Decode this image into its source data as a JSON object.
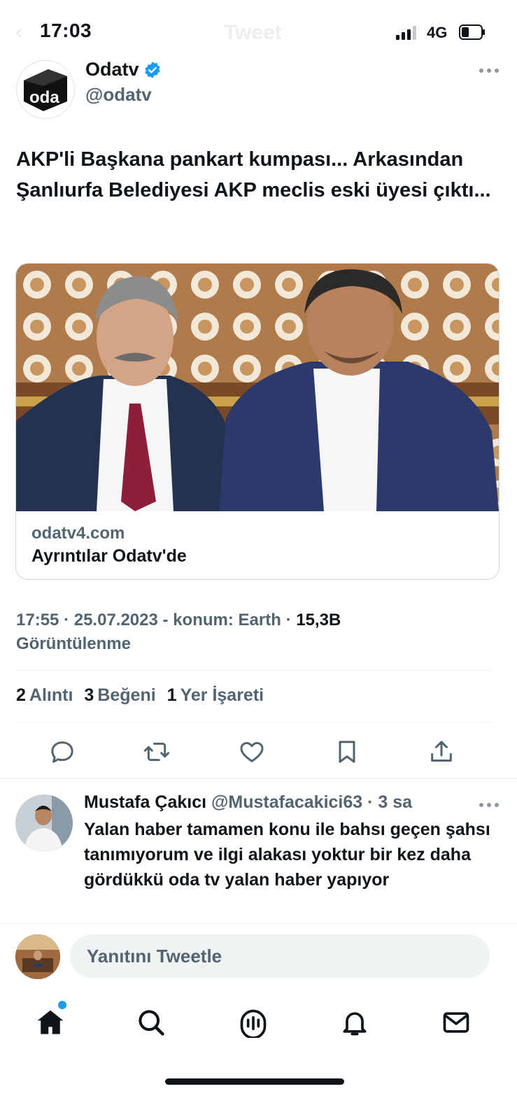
{
  "status_bar": {
    "time": "17:03",
    "network": "4G"
  },
  "background_header": {
    "back_glyph": "‹",
    "title": "Tweet"
  },
  "tweet": {
    "author_name": "Odatv",
    "author_handle": "@odatv",
    "logo_text": "oda",
    "text": "AKP'li Başkana pankart kumpası... Arkasından Şanlıurfa Belediyesi AKP meclis eski üyesi çıktı...",
    "card": {
      "domain": "odatv4.com",
      "title": "Ayrıntılar Odatv'de"
    },
    "meta": {
      "time": "17:55",
      "date": "25.07.2023",
      "location": "konum: Earth",
      "views": "15,3B",
      "views_label": "Görüntülenme"
    },
    "stats": [
      {
        "count": "2",
        "label": "Alıntı"
      },
      {
        "count": "3",
        "label": "Beğeni"
      },
      {
        "count": "1",
        "label": "Yer İşareti"
      }
    ],
    "actions": [
      "reply-icon",
      "retweet-icon",
      "like-icon",
      "bookmark-icon",
      "share-icon"
    ]
  },
  "reply": {
    "name": "Mustafa Çakıcı",
    "handle": "@Mustafacakici63",
    "time": "3 sa",
    "text": "Yalan haber tamamen  konu ile bahsı geçen şahsı tanımıyorum ve ilgi alakası yoktur bir kez daha gördükkü oda tv yalan haber yapıyor"
  },
  "compose": {
    "placeholder": "Yanıtını Tweetle"
  },
  "tab_bar": [
    "home-icon",
    "search-icon",
    "spaces-icon",
    "notifications-icon",
    "messages-icon"
  ],
  "colors": {
    "accent": "#1d9bf0",
    "text": "#0f1419",
    "muted": "#536471",
    "divider": "#eff3f4"
  }
}
